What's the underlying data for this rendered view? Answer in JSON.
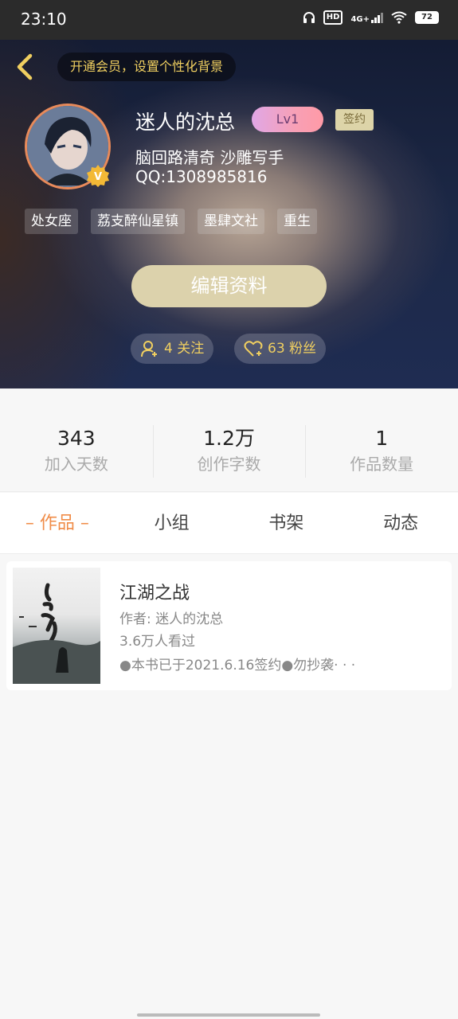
{
  "status_bar": {
    "time": "23:10",
    "hd_label": "HD",
    "network_label": "4G+",
    "battery_level": "72"
  },
  "header": {
    "back_icon": "chevron-left-icon",
    "vip_banner": "开通会员，设置个性化背景",
    "username": "迷人的沈总",
    "level": "Lv1",
    "signed_badge": "签约",
    "bio": "脑回路清奇 沙雕写手",
    "qq": "QQ:1308985816",
    "tags": [
      "处女座",
      "荔支醉仙星镇",
      "墨肆文社",
      "重生"
    ],
    "edit_button": "编辑资料",
    "follow": {
      "icon": "add-user-icon",
      "label": "4 关注"
    },
    "fans": {
      "icon": "heart-plus-icon",
      "label": "63 粉丝"
    },
    "accent_color": "#f0cf60"
  },
  "stats": [
    {
      "value": "343",
      "label": "加入天数"
    },
    {
      "value": "1.2万",
      "label": "创作字数"
    },
    {
      "value": "1",
      "label": "作品数量"
    }
  ],
  "tabs": [
    {
      "label": "– 作品 –",
      "active": true
    },
    {
      "label": "小组",
      "active": false
    },
    {
      "label": "书架",
      "active": false
    },
    {
      "label": "动态",
      "active": false
    }
  ],
  "books": [
    {
      "title": "江湖之战",
      "author": "作者: 迷人的沈总",
      "views": "3.6万人看过",
      "notice": "●本书已于2021.6.16签约●勿抄袭· · ·"
    }
  ],
  "colors": {
    "active_tab": "#f08c48",
    "edit_button": "#dcd2ac",
    "level_pill": "#f7a0b6"
  }
}
